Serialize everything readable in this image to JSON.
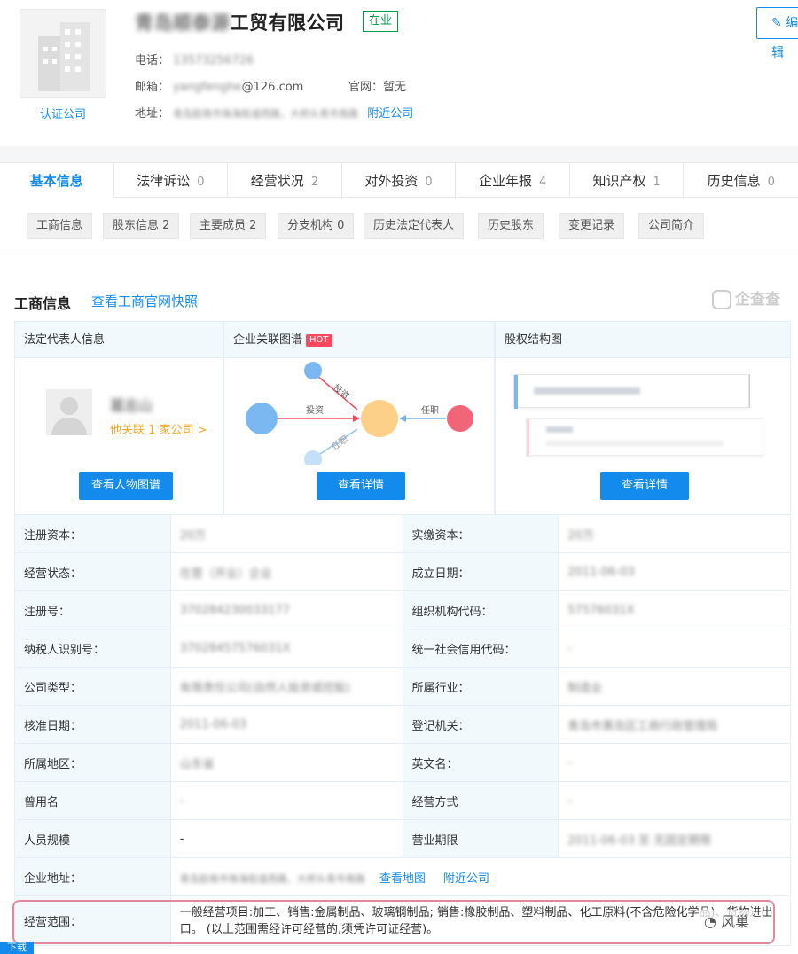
{
  "header": {
    "logo_label": "认证公司",
    "company_name_blurred": "青岛顺泰源",
    "company_name_visible": "工贸有限公司",
    "status": "在业",
    "edit_button": "编辑",
    "phone_label": "电话：",
    "phone_value": "13573256726",
    "email_label": "邮箱：",
    "email_blurred": "yangfenghe",
    "email_domain": "@126.com",
    "website_label": "官网：",
    "website_value": "暂无",
    "address_label": "地址：",
    "address_value": "青岛胶南市珠海街道西路，大桥头青市南路",
    "nearby_link": "附近公司"
  },
  "tabs": [
    {
      "label": "基本信息",
      "count": ""
    },
    {
      "label": "法律诉讼",
      "count": "0"
    },
    {
      "label": "经营状况",
      "count": "2"
    },
    {
      "label": "对外投资",
      "count": "0"
    },
    {
      "label": "企业年报",
      "count": "4"
    },
    {
      "label": "知识产权",
      "count": "1"
    },
    {
      "label": "历史信息",
      "count": "0"
    }
  ],
  "subtabs": [
    "工商信息",
    "股东信息 2",
    "主要成员 2",
    "分支机构 0",
    "历史法定代表人",
    "历史股东",
    "变更记录",
    "公司简介"
  ],
  "section": {
    "title": "工商信息",
    "snapshot_link": "查看工商官网快照",
    "watermark": "企查查"
  },
  "cards": {
    "legal_rep": {
      "head": "法定代表人信息",
      "name": "葛志山",
      "related": "他关联 1 家公司 >",
      "button": "查看人物图谱"
    },
    "relation": {
      "head": "企业关联图谱",
      "hot": "HOT",
      "edge_invest1": "投资",
      "edge_invest2": "投资",
      "edge_role1": "任职",
      "edge_role2": "任职",
      "button": "查看详情"
    },
    "equity": {
      "head": "股权结构图",
      "button": "查看详情"
    }
  },
  "info_rows": [
    {
      "l1": "注册资本：",
      "v1": "20万",
      "l2": "实缴资本：",
      "v2": "20万"
    },
    {
      "l1": "经营状态：",
      "v1": "在营（开业）企业",
      "l2": "成立日期：",
      "v2": "2011-06-03"
    },
    {
      "l1": "注册号：",
      "v1": "370284230033177",
      "l2": "组织机构代码：",
      "v2": "57576031X"
    },
    {
      "l1": "纳税人识别号：",
      "v1": "37028457576031X",
      "l2": "统一社会信用代码：",
      "v2": "-"
    },
    {
      "l1": "公司类型：",
      "v1": "有限责任公司(自然人投资或控股)",
      "l2": "所属行业：",
      "v2": "制造业"
    },
    {
      "l1": "核准日期：",
      "v1": "2011-06-03",
      "l2": "登记机关：",
      "v2": "青岛市黄岛区工商行政管理局"
    },
    {
      "l1": "所属地区：",
      "v1": "山东省",
      "l2": "英文名：",
      "v2": "-"
    },
    {
      "l1": "曾用名",
      "v1": "-",
      "l2": "经营方式",
      "v2": "-"
    },
    {
      "l1": "人员规模",
      "v1": "-",
      "l2": "营业期限",
      "v2": "2011-06-03 至 无固定期限"
    }
  ],
  "address_row": {
    "label": "企业地址：",
    "value": "青岛胶南市珠海街道西路，大桥头青市南路",
    "map_link": "查看地图",
    "nearby_link": "附近公司"
  },
  "range_row": {
    "label": "经营范围：",
    "value": "一般经营项目:加工、销售:金属制品、玻璃钢制品; 销售:橡胶制品、塑料制品、化工原料(不含危险化学品)、货物进出口。 (以上范围需经许可经营的,须凭许可证经营)。"
  },
  "watermark_bottom": "风巢",
  "bottom_tag": "下载"
}
